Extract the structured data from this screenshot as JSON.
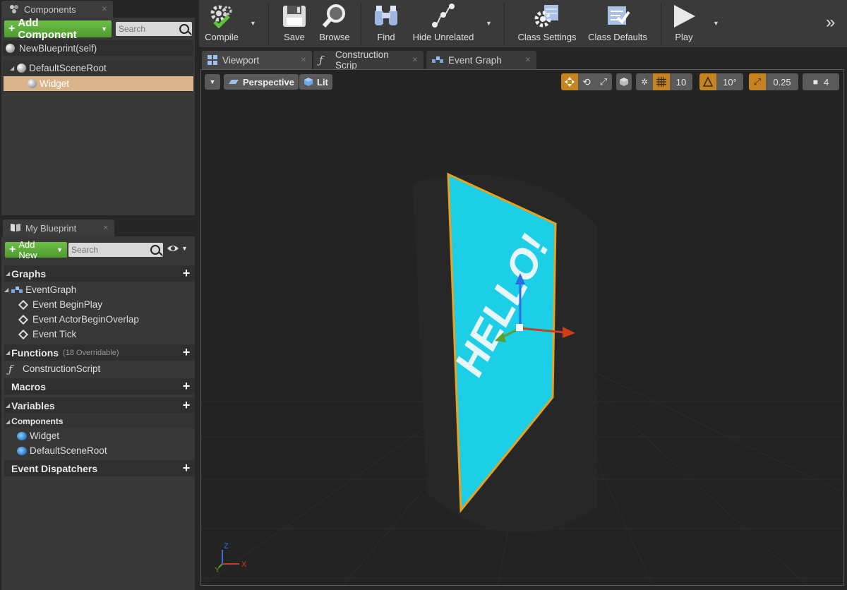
{
  "components_panel": {
    "tab_label": "Components",
    "add_button": "Add Component",
    "search_placeholder": "Search",
    "self_item": "NewBlueprint(self)",
    "tree": [
      {
        "label": "DefaultSceneRoot"
      },
      {
        "label": "Widget"
      }
    ]
  },
  "my_blueprint": {
    "tab_label": "My Blueprint",
    "add_button": "Add New",
    "search_placeholder": "Search",
    "sections": {
      "graphs": "Graphs",
      "functions": "Functions",
      "functions_sub": "(18 Overridable)",
      "macros": "Macros",
      "variables": "Variables",
      "components_header": "Components",
      "event_dispatchers": "Event Dispatchers"
    },
    "graphs_items": {
      "event_graph": "EventGraph",
      "events": [
        "Event BeginPlay",
        "Event ActorBeginOverlap",
        "Event Tick"
      ]
    },
    "functions_items": [
      "ConstructionScript"
    ],
    "variables_components": [
      "Widget",
      "DefaultSceneRoot"
    ]
  },
  "toolbar": {
    "compile": "Compile",
    "save": "Save",
    "browse": "Browse",
    "find": "Find",
    "hide_unrelated": "Hide Unrelated",
    "class_settings": "Class Settings",
    "class_defaults": "Class Defaults",
    "play": "Play"
  },
  "editor_tabs": [
    "Viewport",
    "Construction Scrip",
    "Event Graph"
  ],
  "viewport": {
    "perspective": "Perspective",
    "lit": "Lit",
    "grid_snap": "10",
    "rotation_snap": "10°",
    "scale_snap": "0.25",
    "camera_speed": "4",
    "widget_text": "HELLO!",
    "axis_z": "Z",
    "axis_x": "X",
    "axis_y": "Y"
  },
  "colors": {
    "accent_green": "#4f9a30",
    "selection": "#d9b48a",
    "snap_orange": "#c68421",
    "widget_cyan": "#1ccfe6",
    "widget_outline": "#e8a21f"
  }
}
